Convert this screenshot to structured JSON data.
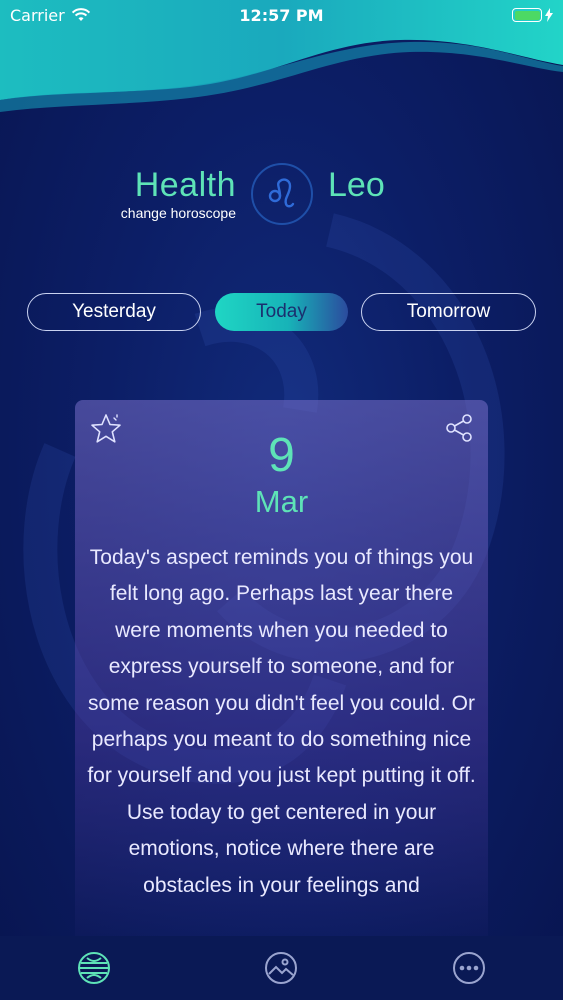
{
  "status_bar": {
    "carrier": "Carrier",
    "time": "12:57 PM"
  },
  "header": {
    "category": "Health",
    "change_link": "change horoscope",
    "sign_name": "Leo",
    "sign_icon": "leo-zodiac-icon"
  },
  "tabs": [
    {
      "label": "Yesterday",
      "selected": false
    },
    {
      "label": "Today",
      "selected": true
    },
    {
      "label": "Tomorrow",
      "selected": false
    }
  ],
  "card": {
    "day": "9",
    "month": "Mar",
    "reading": "Today's aspect reminds you of things you felt long ago. Perhaps last year there were moments when you needed to express yourself to someone, and for some reason you didn't feel you could. Or perhaps you meant to do something nice for yourself and you just kept putting it off. Use today to get centered in your emotions, notice where there are obstacles in your feelings and",
    "icons": [
      "star-icon",
      "share-icon"
    ]
  },
  "bottom_tabs": [
    {
      "icon": "globe-icon",
      "active": true
    },
    {
      "icon": "image-icon",
      "active": false
    },
    {
      "icon": "more-icon",
      "active": false
    }
  ],
  "colors": {
    "accent": "#5ee3b7",
    "background": "#0c1e66",
    "tab_gradient_start": "#1fd6c4"
  }
}
